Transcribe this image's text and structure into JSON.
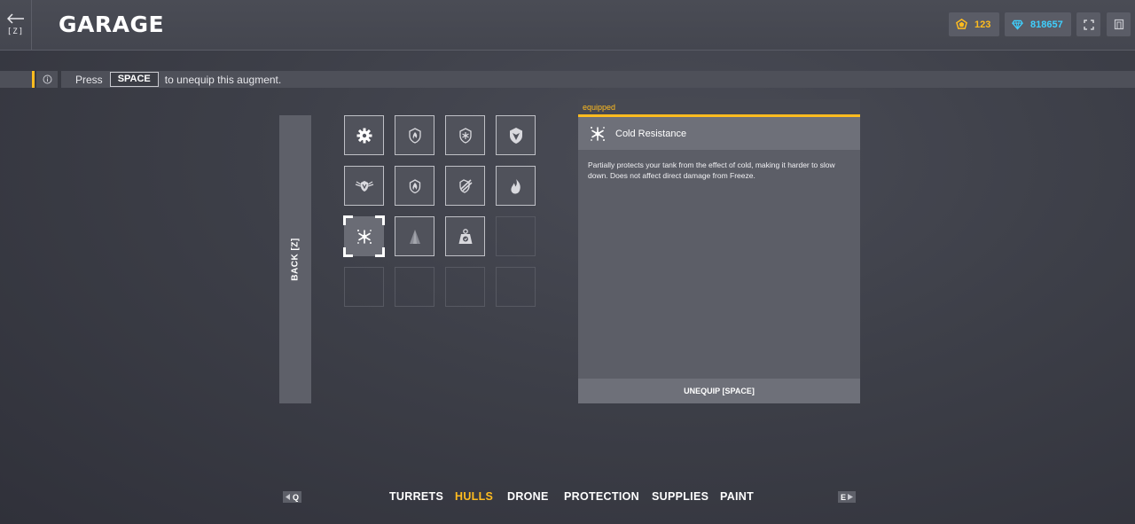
{
  "header": {
    "back_key": "[Z]",
    "title": "GARAGE",
    "crystals": "123",
    "gems": "818657"
  },
  "hint": {
    "pre": "Press",
    "key": "SPACE",
    "post": "to unequip this augment."
  },
  "back_panel_label": "BACK [Z]",
  "augments": [
    {
      "icon": "gear-icon",
      "state": "owned"
    },
    {
      "icon": "fire-shield-icon",
      "state": "owned"
    },
    {
      "icon": "freeze-shield-icon",
      "state": "owned"
    },
    {
      "icon": "shield-icon",
      "state": "owned"
    },
    {
      "icon": "winged-shield-icon",
      "state": "owned"
    },
    {
      "icon": "flame-shield-icon",
      "state": "owned"
    },
    {
      "icon": "slash-shield-icon",
      "state": "owned"
    },
    {
      "icon": "flame-icon",
      "state": "owned"
    },
    {
      "icon": "snowflake-icon",
      "state": "selected"
    },
    {
      "icon": "cone-icon",
      "state": "owned"
    },
    {
      "icon": "weight-icon",
      "state": "owned"
    },
    {
      "icon": "",
      "state": "empty"
    },
    {
      "icon": "",
      "state": "empty"
    },
    {
      "icon": "",
      "state": "empty"
    },
    {
      "icon": "",
      "state": "empty"
    },
    {
      "icon": "",
      "state": "empty"
    }
  ],
  "info": {
    "tag": "equipped",
    "name": "Cold Resistance",
    "description": "Partially protects your tank from the effect of cold, making it harder to slow down. Does not affect direct damage from Freeze.",
    "unequip_label": "UNEQUIP [SPACE]"
  },
  "nav": {
    "prev_key": "Q",
    "next_key": "E",
    "tabs": [
      {
        "label": "TURRETS",
        "active": false
      },
      {
        "label": "HULLS",
        "active": true
      },
      {
        "label": "DRONE",
        "active": false
      },
      {
        "label": "PROTECTION",
        "active": false
      },
      {
        "label": "SUPPLIES",
        "active": false
      },
      {
        "label": "PAINT",
        "active": false
      }
    ]
  },
  "colors": {
    "accent": "#ffbc1f",
    "gems": "#3fd0ff"
  }
}
